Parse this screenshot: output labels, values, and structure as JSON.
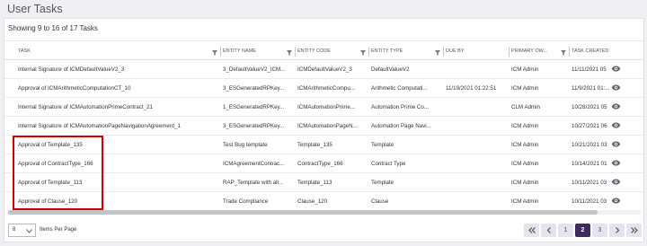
{
  "page_title": "User Tasks",
  "showing_text": "Showing 9 to 16 of 17 Tasks",
  "columns": [
    {
      "label": "TASK"
    },
    {
      "label": "ENTITY NAME"
    },
    {
      "label": "ENTITY CODE"
    },
    {
      "label": "ENTITY TYPE"
    },
    {
      "label": "DUE BY"
    },
    {
      "label": "PRIMARY OW..."
    },
    {
      "label": "TASK CREATED"
    }
  ],
  "rows": [
    {
      "task": "Internal Signature of ICMDefaultValueV2_3",
      "entity_name": "3_DefaultValueV2_ICM...",
      "entity_code": "ICMDefaultValueV2_3",
      "entity_type": "DefaultValueV2",
      "due_by": "",
      "owner": "ICM Admin",
      "created": "11/11/2021 05"
    },
    {
      "task": "Approval of ICMArithmeticComputationCT_10",
      "entity_name": "3_ESGeneratedRPKey...",
      "entity_code": "ICMArithmeticCompu...",
      "entity_type": "Arithmetic Computati...",
      "due_by": "11/19/2021 01:22:51",
      "owner": "ICM Admin",
      "created": "11/9/2021 01:..."
    },
    {
      "task": "Internal Signature of ICMAutomationPrimeContract_21",
      "entity_name": "1_ESGeneratedRPKey...",
      "entity_code": "ICMAutomationPrime...",
      "entity_type": "Automation Prime Co...",
      "due_by": "",
      "owner": "CLM Admin",
      "created": "10/28/2021 05"
    },
    {
      "task": "Internal Signature of ICMAutomationPageNavigationAgreement_1",
      "entity_name": "3_ESGeneratedRPKey...",
      "entity_code": "ICMAutomationPageN...",
      "entity_type": "Automation Page Navi...",
      "due_by": "",
      "owner": "ICM Admin",
      "created": "10/27/2021 06"
    },
    {
      "task": "Approval of Template_135",
      "entity_name": "Test Bug template",
      "entity_code": "Template_135",
      "entity_type": "Template",
      "due_by": "",
      "owner": "ICM Admin",
      "created": "10/21/2021 03"
    },
    {
      "task": "Approval of ContractType_166",
      "entity_name": "ICMAgreementContrac...",
      "entity_code": "ContractType_166",
      "entity_type": "Contract Type",
      "due_by": "",
      "owner": "ICM Admin",
      "created": "10/14/2021 01"
    },
    {
      "task": "Approval of Template_113",
      "entity_name": "RAP_Template with all...",
      "entity_code": "Template_113",
      "entity_type": "Template",
      "due_by": "",
      "owner": "ICM Admin",
      "created": "10/11/2021 03"
    },
    {
      "task": "Approval of Clause_120",
      "entity_name": "Trade Compliance",
      "entity_code": "Clause_120",
      "entity_type": "Clause",
      "due_by": "",
      "owner": "ICM Admin",
      "created": "10/11/2021 03"
    }
  ],
  "row_action_icon": "eye-icon",
  "pagination": {
    "items_per_page": "8",
    "items_per_page_label": "Items Per Page",
    "pages": [
      "1",
      "2",
      "3"
    ],
    "current_page": "2"
  },
  "colors": {
    "accent": "#3a2c5c",
    "pager_button": "#e6e2ee",
    "highlight": "#d00000",
    "icon": "#5a6270"
  }
}
